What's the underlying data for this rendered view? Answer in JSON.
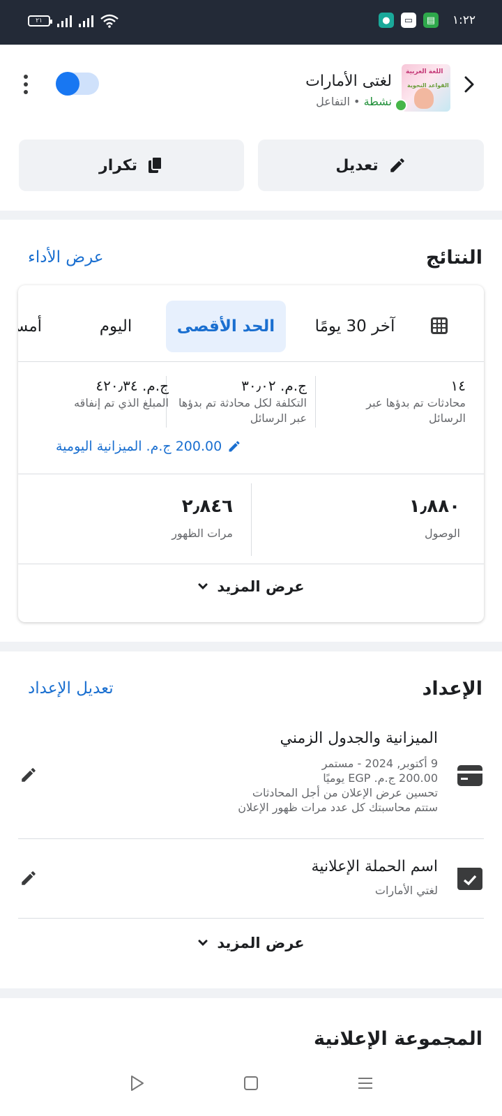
{
  "status_bar": {
    "time": "١:٢٢",
    "battery": "٢١",
    "app_icons": [
      "messenger-icon",
      "notification-icon",
      "chat-icon"
    ]
  },
  "header": {
    "page_name": "لغتى الأمارات",
    "status_active": "نشطة",
    "status_separator": "•",
    "status_type": "التفاعل",
    "thumb_line1": "اللغة العربية",
    "thumb_line2": "القواعد النحوية",
    "toggle_on": true
  },
  "actions": {
    "edit_label": "تعديل",
    "duplicate_label": "تكرار"
  },
  "results": {
    "title": "النتائج",
    "view_performance": "عرض الأداء",
    "tabs": [
      "آخر 30 يومًا",
      "الحد الأقصى",
      "اليوم",
      "أمس"
    ],
    "selected_tab": "الحد الأقصى",
    "metrics": [
      {
        "value": "١٤",
        "label": "محادثات تم بدؤها عبر الرسائل"
      },
      {
        "value": "ج.م. ٣٠٫٠٢",
        "label": "التكلفة لكل محادثة تم بدؤها عبر الرسائل"
      },
      {
        "value": "ج.م. ٤٢٠٫٣٤",
        "label": "المبلغ الذي تم إنفاقه"
      }
    ],
    "daily_budget": "200.00 ج.م. الميزانية اليومية",
    "reach": {
      "value": "١٫٨٨٠",
      "label": "الوصول"
    },
    "impressions": {
      "value": "٢٫٨٤٦",
      "label": "مرات الظهور"
    },
    "see_more": "عرض المزيد"
  },
  "setup": {
    "title": "الإعداد",
    "edit_link": "تعديل الإعداد",
    "budget_row": {
      "title": "الميزانية والجدول الزمني",
      "lines": [
        "9 أكتوبر, 2024 - مستمر",
        "200.00 ج.م. EGP يوميًا",
        "تحسين عرض الإعلان من أجل المحادثات",
        "ستتم محاسبتك كل عدد مرات ظهور الإعلان"
      ]
    },
    "campaign_row": {
      "title": "اسم الحملة الإعلانية",
      "subtitle": "لغتي الأمارات"
    },
    "see_more": "عرض المزيد"
  },
  "adset": {
    "title": "المجموعة الإعلانية"
  },
  "colors": {
    "accent": "#1877f2",
    "link": "#1a6fd0",
    "status_bar": "#232a37",
    "active_green": "#46b648",
    "selected_tab_bg": "#e7f0fd"
  }
}
